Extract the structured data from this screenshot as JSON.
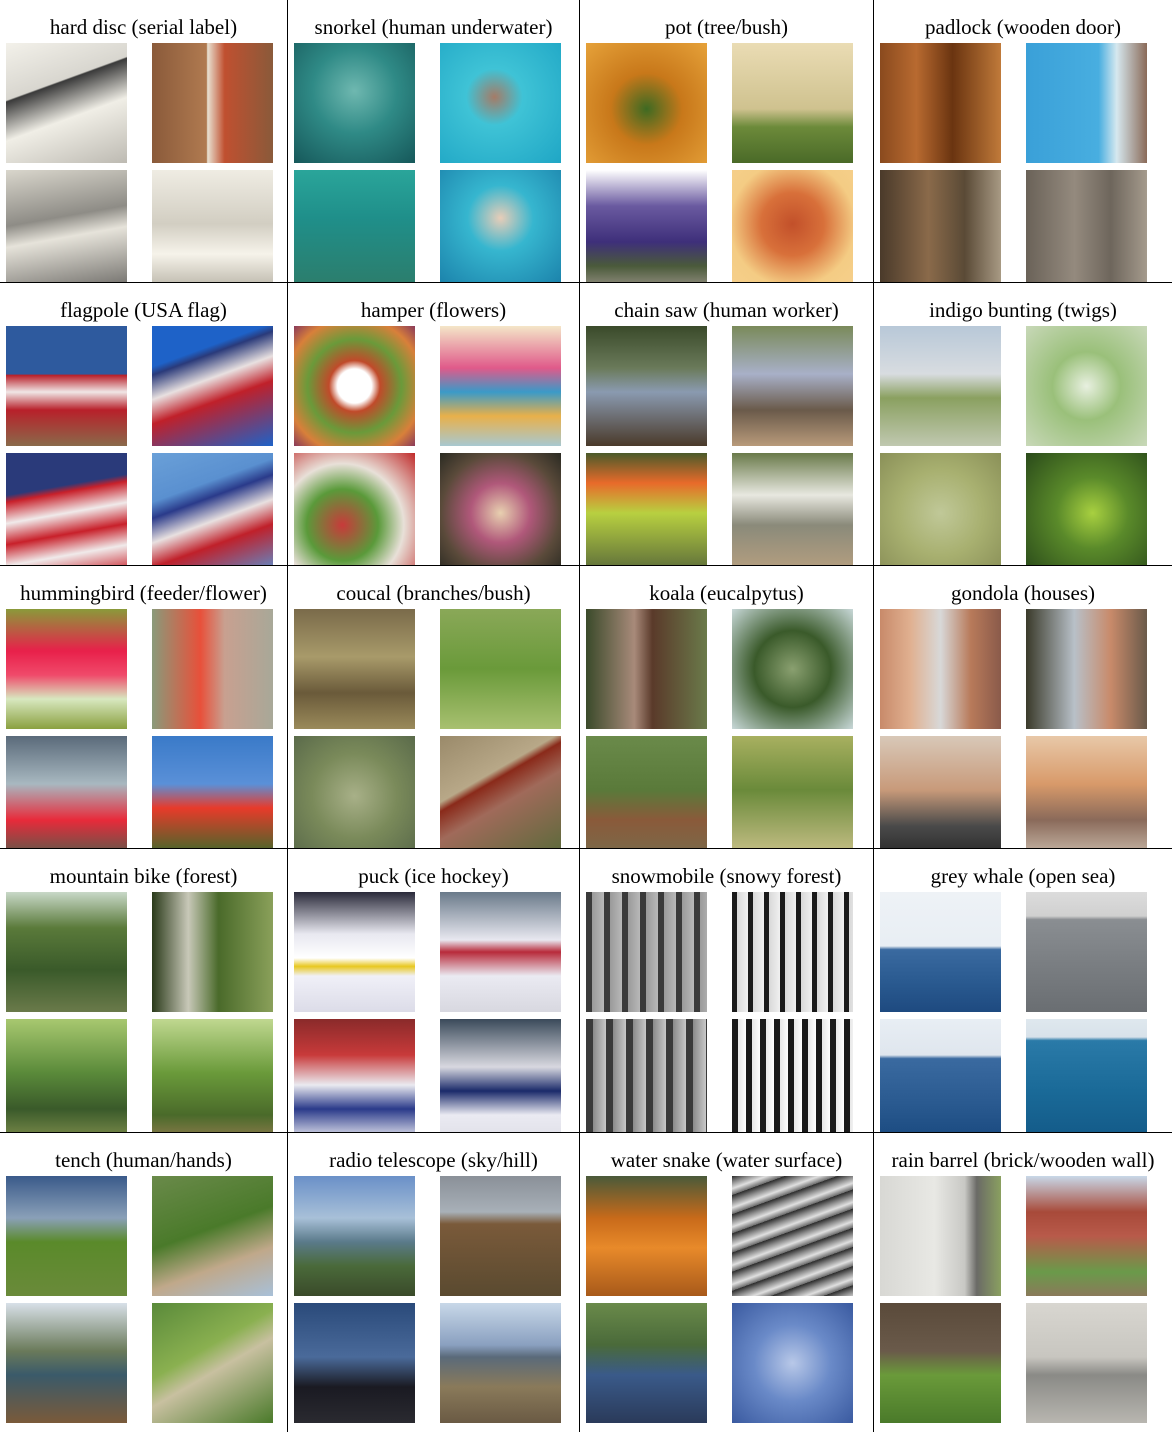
{
  "panels": [
    {
      "title": "hard disc (serial label)",
      "thumbs": [
        "linear-gradient(160deg,#f3f1ea 0%,#d8d6cf 35%,#3a3a3a 36%,#f0eee6 60%,#bdbab2 100%)",
        "linear-gradient(90deg,#8a5a3a 0%,#b07a50 45%,#e8e0d0 46%,#c05030 60%,#8a5a3a 100%)",
        "linear-gradient(170deg,#d9d6cc 0%,#8e8c86 40%,#e6e3da 55%,#6c6a66 100%)",
        "linear-gradient(180deg,#efece3 0%,#d2cec2 45%,#f6f3ea 70%,#b8b3a6 100%)"
      ]
    },
    {
      "title": "snorkel (human underwater)",
      "thumbs": [
        "radial-gradient(circle at 50% 40%,#6fb8b0 0%,#2f8a86 45%,#16585a 100%)",
        "radial-gradient(circle at 45% 45%,#a57b67 0%,#3fc3d6 30%,#1fa6c5 100%)",
        "linear-gradient(180deg,#2aa59a 0%,#1f8f8a 40%,#2d7c6a 100%)",
        "radial-gradient(circle at 50% 40%,#e8cdb8 0%,#36b6cf 35%,#197ea8 100%)"
      ]
    },
    {
      "title": "pot (tree/bush)",
      "thumbs": [
        "radial-gradient(circle at 50% 55%,#3e6a22 0%,#c8781a 40%,#e6a23a 100%)",
        "linear-gradient(180deg,#eadcb4 0%,#cfc28f 55%,#6c8a3a 70%,#4a6a28 100%)",
        "linear-gradient(180deg,#ffffff 0%,#6a5aa0 30%,#3e2f7a 60%,#4a5a3a 80%,#9a9488 100%)",
        "radial-gradient(circle at 50% 45%,#c2502a 0%,#d8703a 35%,#f4cc84 70%,#f6d08c 100%)"
      ]
    },
    {
      "title": "padlock (wooden door)",
      "thumbs": [
        "linear-gradient(90deg,#8a4a1e 0%,#b86a30 30%,#6a3410 60%,#c07a3a 100%)",
        "linear-gradient(90deg,#3aa0d8 0%,#48aee0 60%,#d6e8ef 75%,#8a6a58 100%)",
        "linear-gradient(90deg,#4a3a2a 0%,#8a6a4a 40%,#5a4a36 70%,#a89a84 100%)",
        "linear-gradient(90deg,#6a6258 0%,#948a7e 40%,#6e665c 70%,#a49a8c 100%)"
      ]
    },
    {
      "title": "flagpole (USA flag)",
      "thumbs": [
        "linear-gradient(180deg,#2e5a9e 0%,#2e5a9e 40%,#b8202a 41%,#f0e6e6 55%,#b8202a 70%,#8a6a4a 100%)",
        "linear-gradient(160deg,#1e62c8 0%,#1e62c8 25%,#2a3a7a 30%,#e8e0e0 45%,#c0202a 60%,#1e62c8 100%)",
        "linear-gradient(170deg,#2a3a7a 0%,#2a3a7a 30%,#c8202a 35%,#f0eaea 50%,#c8202a 65%,#f0eaea 80%,#c8202a 100%)",
        "linear-gradient(160deg,#6aa0d8 0%,#5a90d0 30%,#2a3a8a 40%,#e8e0e0 55%,#c0202a 70%,#5a90d0 100%)"
      ]
    },
    {
      "title": "hamper (flowers)",
      "thumbs": [
        "radial-gradient(circle at 50% 50%,#ffffff 0%,#ffffff 20%,#c04a2a 30%,#6a9a3a 55%,#d8803a 80%,#8a3a5a 100%)",
        "linear-gradient(180deg,#f4e6c8 0%,#e05a8a 35%,#3a9ac8 55%,#e8b04a 75%,#a8c8d0 100%)",
        "radial-gradient(circle at 40% 60%,#c83a3a 0%,#5a9a3a 35%,#e8e0d8 60%,#c02a2a 100%)",
        "radial-gradient(circle at 50% 50%,#e8d0b0 0%,#b0587a 35%,#5a4a3a 70%,#2a2a22 100%)"
      ]
    },
    {
      "title": "chain saw (human worker)",
      "thumbs": [
        "linear-gradient(180deg,#3a4a2a 0%,#6a7a5a 35%,#8a9ab0 55%,#4a3a2a 100%)",
        "linear-gradient(180deg,#7a8a5a 0%,#a8b0c8 40%,#6a5a4a 70%,#b89a7a 100%)",
        "linear-gradient(180deg,#4a5a2a 0%,#e86a2a 25%,#b8d040 50%,#5a6a3a 100%)",
        "linear-gradient(180deg,#6a7a4a 0%,#e8e8e0 35%,#8a8a7a 60%,#b8a080 100%)"
      ]
    },
    {
      "title": "indigo bunting (twigs)",
      "thumbs": [
        "linear-gradient(180deg,#b8c8d8 0%,#d8dce0 40%,#8aa060 60%,#c0c8b0 100%)",
        "radial-gradient(circle at 50% 50%,#e8f0e0 0%,#9ac07a 40%,#c8d8b8 100%)",
        "radial-gradient(circle at 50% 50%,#c0c898 0%,#a8b070 50%,#8a9058 100%)",
        "radial-gradient(circle at 55% 50%,#a8d040 0%,#5a8a2a 40%,#2a4a1a 100%)"
      ]
    },
    {
      "title": "hummingbird (feeder/flower)",
      "thumbs": [
        "linear-gradient(180deg,#8a9a3a 0%,#e8204a 35%,#f04a6a 55%,#d8e8c0 75%,#8aa040 100%)",
        "linear-gradient(90deg,#8a9a7a 0%,#e8503a 40%,#c8a090 60%,#a8a898 100%)",
        "linear-gradient(180deg,#5a6a7a 0%,#a8b8c0 40%,#e82a3a 70%,#5a5a4a 100%)",
        "linear-gradient(180deg,#3a7ac8 0%,#5a90d8 40%,#e83a2a 60%,#3a6a2a 100%)"
      ]
    },
    {
      "title": "coucal (branches/bush)",
      "thumbs": [
        "linear-gradient(180deg,#7a6a4a 0%,#a89a6a 40%,#6a5a3a 70%,#9a8a5a 100%)",
        "linear-gradient(180deg,#8aa858 0%,#6a9a3a 50%,#a8c070 100%)",
        "radial-gradient(circle at 50% 50%,#a8b088 0%,#7a8a5a 50%,#5a6a4a 100%)",
        "linear-gradient(150deg,#9a8a6a 0%,#b8a888 35%,#8a2a1a 40%,#a06a5a 55%,#5a6a3a 100%)"
      ]
    },
    {
      "title": "koala (eucalpytus)",
      "thumbs": [
        "linear-gradient(90deg,#3a4a2a 0%,#a88a7a 40%,#5a3a2a 55%,#6a7a4a 100%)",
        "radial-gradient(circle at 50% 50%,#8aa070 0%,#3a5a2a 45%,#c8d8d8 100%)",
        "linear-gradient(180deg,#6a8a4a 0%,#5a7a3a 45%,#8a5a3a 70%,#7a6a4a 100%)",
        "linear-gradient(180deg,#a8b060 0%,#6a8a3a 45%,#c8c088 100%)"
      ]
    },
    {
      "title": "gondola (houses)",
      "thumbs": [
        "linear-gradient(90deg,#c88a6a 0%,#e0b090 25%,#d8d8d8 50%,#b87a5a 75%,#8a5a4a 100%)",
        "linear-gradient(90deg,#3a3a2a 0%,#b8c0c8 40%,#c88a6a 70%,#6a5a4a 100%)",
        "linear-gradient(180deg,#d8c8b8 0%,#c89a7a 45%,#4a4a4a 75%,#2a2a2a 100%)",
        "linear-gradient(180deg,#e8c8a8 0%,#d89a6a 40%,#8a6a5a 70%,#c8b8a8 100%)"
      ]
    },
    {
      "title": "mountain bike (forest)",
      "thumbs": [
        "linear-gradient(180deg,#c8d8c8 0%,#5a7a3a 30%,#3a5a2a 65%,#6a7a4a 100%)",
        "linear-gradient(90deg,#2a3a1a 0%,#c8c8b8 30%,#4a6a2a 55%,#8aa05a 100%)",
        "linear-gradient(180deg,#a8c870 0%,#5a8a3a 45%,#3a5a2a 75%,#7a8a4a 100%)",
        "linear-gradient(180deg,#c0d890 0%,#6a9a3a 45%,#4a6a2a 80%,#8a7a4a 100%)"
      ]
    },
    {
      "title": "puck (ice hockey)",
      "thumbs": [
        "linear-gradient(180deg,#2a2a3a 0%,#e8e8f0 35%,#ffffff 55%,#e8c820 62%,#f0f0f8 70%,#dcdce8 100%)",
        "linear-gradient(180deg,#6a7a8a 0%,#e8e8f0 40%,#b82a3a 50%,#eaeaf2 70%,#d8d8e0 100%)",
        "linear-gradient(180deg,#8a2a2a 0%,#c83a3a 30%,#eaeaf0 55%,#2a3a8a 75%,#e8e8f0 100%)",
        "linear-gradient(180deg,#3a4a5a 0%,#d8d8e0 40%,#1a2a6a 60%,#eaeaf2 80%,#e0e0e8 100%)"
      ]
    },
    {
      "title": "snowmobile (snowy forest)",
      "thumbs": [
        "repeating-linear-gradient(90deg,#3a3a3a 0px,#3a3a3a 6px,#9a9a9a 6px,#b8b8b8 18px)",
        "repeating-linear-gradient(90deg,#1a1a1a 0px,#1a1a1a 5px,#d8d8d8 5px,#f0f0f0 16px)",
        "repeating-linear-gradient(90deg,#3a3a3a 0px,#3a3a3a 7px,#8a8a8a 7px,#c8c8c8 20px)",
        "repeating-linear-gradient(90deg,#1a1a1a 0px,#1a1a1a 6px,#e8e8e8 6px,#ffffff 14px)"
      ]
    },
    {
      "title": "grey whale (open sea)",
      "thumbs": [
        "linear-gradient(180deg,#eef2f6 0%,#e8eef4 45%,#3a6aa0 48%,#2a5a90 75%,#1e4a80 100%)",
        "linear-gradient(180deg,#dcdcdc 0%,#d0d0d0 20%,#8a8e92 23%,#7a7e82 60%,#6a6e72 100%)",
        "linear-gradient(180deg,#e8eef4 0%,#dfe6ee 30%,#3a6aa0 33%,#2a5a90 70%,#1a4a80 100%)",
        "linear-gradient(180deg,#dfe8ee 0%,#d8e2ea 15%,#2a7aa8 18%,#1a6a98 60%,#135a88 100%)"
      ]
    },
    {
      "title": "tench (human/hands)",
      "thumbs": [
        "linear-gradient(180deg,#3a5a8a 0%,#8aa0b8 35%,#5a8a2a 55%,#6a8a3a 100%)",
        "linear-gradient(160deg,#6a8a4a 0%,#4a7a2a 45%,#c0a88a 70%,#a8c0d8 100%)",
        "linear-gradient(180deg,#d8e0e8 0%,#6a7a5a 40%,#3a5a6a 60%,#7a5a3a 100%)",
        "linear-gradient(150deg,#5a8a3a 0%,#8ab050 40%,#c8c0a0 55%,#4a7a2a 100%)"
      ]
    },
    {
      "title": "radio telescope (sky/hill)",
      "thumbs": [
        "linear-gradient(180deg,#6a90c8 0%,#a8c0d8 35%,#5a7a8a 55%,#4a6a3a 75%,#3a4a2a 100%)",
        "linear-gradient(180deg,#8a9098 0%,#a8b0b8 30%,#7a5a3a 40%,#5a4a30 100%)",
        "linear-gradient(180deg,#2a4a7a 0%,#4a6a9a 45%,#1a1a22 70%,#2a2a30 100%)",
        "linear-gradient(180deg,#c8d8e8 0%,#8aa0c0 35%,#5a6a7a 45%,#8a7a5a 70%,#6a5a44 100%)"
      ]
    },
    {
      "title": "water snake (water surface)",
      "thumbs": [
        "linear-gradient(180deg,#4a5a3a 0%,#c86a1a 35%,#e88a2a 60%,#a85a1a 100%)",
        "repeating-linear-gradient(160deg,#2a2a2a 0px,#8a8a8a 6px,#e0e0e0 12px,#6a6a6a 18px)",
        "linear-gradient(180deg,#6a8a4a 0%,#4a6a3a 35%,#3a5a8a 60%,#2a3a5a 100%)",
        "radial-gradient(circle at 50% 50%,#b8c8e8 0%,#6a8ac8 45%,#3a5aa0 100%)"
      ]
    },
    {
      "title": "rain barrel (brick/wooden wall)",
      "thumbs": [
        "linear-gradient(90deg,#d8d8d4 0%,#e8e8e4 45%,#c8c8c4 70%,#6a6a66 80%,#8aa060 100%)",
        "linear-gradient(180deg,#c8d8e8 0%,#a84a3a 30%,#b85a4a 50%,#6a9a4a 80%,#8a7a5a 100%)",
        "linear-gradient(180deg,#5a4a3a 0%,#6a5a4a 40%,#6a9a3a 60%,#4a7a2a 100%)",
        "linear-gradient(180deg,#d8d6d0 0%,#c8c6c0 45%,#8a8a86 60%,#b8b6b0 100%)"
      ]
    }
  ]
}
